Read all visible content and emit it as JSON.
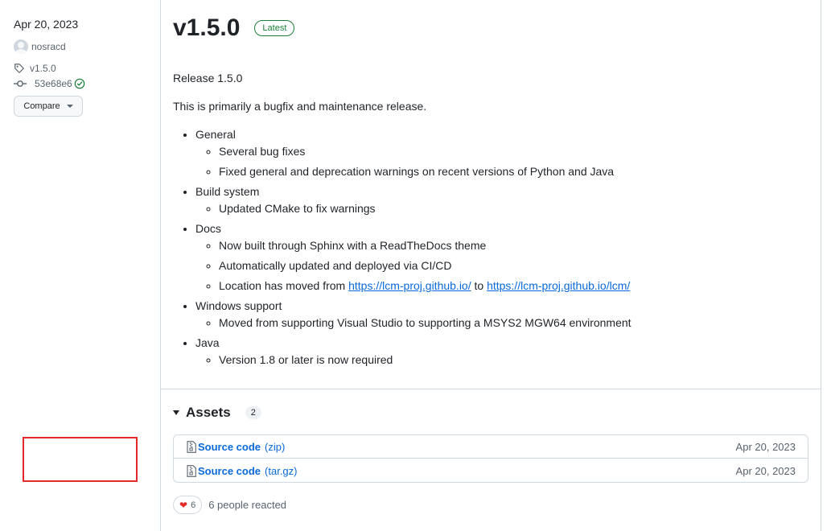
{
  "sidebar": {
    "date": "Apr 20, 2023",
    "author": "nosracd",
    "tag": "v1.5.0",
    "commit": "53e68e6",
    "compare_label": "Compare"
  },
  "release": {
    "title": "v1.5.0",
    "badge": "Latest",
    "heading": "Release 1.5.0",
    "summary": "This is primarily a bugfix and maintenance release.",
    "sections": [
      {
        "label": "General",
        "items": [
          "Several bug fixes",
          "Fixed general and deprecation warnings on recent versions of Python and Java"
        ]
      },
      {
        "label": "Build system",
        "items": [
          "Updated CMake to fix warnings"
        ]
      },
      {
        "label": "Docs",
        "items": [
          "Now built through Sphinx with a ReadTheDocs theme",
          "Automatically updated and deployed via CI/CD"
        ]
      },
      {
        "label": "Windows support",
        "items": [
          "Moved from supporting Visual Studio to supporting a MSYS2 MGW64 environment"
        ]
      },
      {
        "label": "Java",
        "items": [
          "Version 1.8 or later is now required"
        ]
      }
    ],
    "docs_location": {
      "prefix": "Location has moved from ",
      "old_url": "https://lcm-proj.github.io/",
      "middle": " to ",
      "new_url": "https://lcm-proj.github.io/lcm/"
    }
  },
  "assets": {
    "title": "Assets",
    "count": "2",
    "items": [
      {
        "name": "Source code",
        "format": "(zip)",
        "date": "Apr 20, 2023"
      },
      {
        "name": "Source code",
        "format": "(tar.gz)",
        "date": "Apr 20, 2023"
      }
    ]
  },
  "reactions": {
    "heart_count": "6",
    "text": "6 people reacted"
  },
  "colors": {
    "link": "#0969da",
    "latest": "#1a7f37",
    "highlight": "#e5282a"
  }
}
